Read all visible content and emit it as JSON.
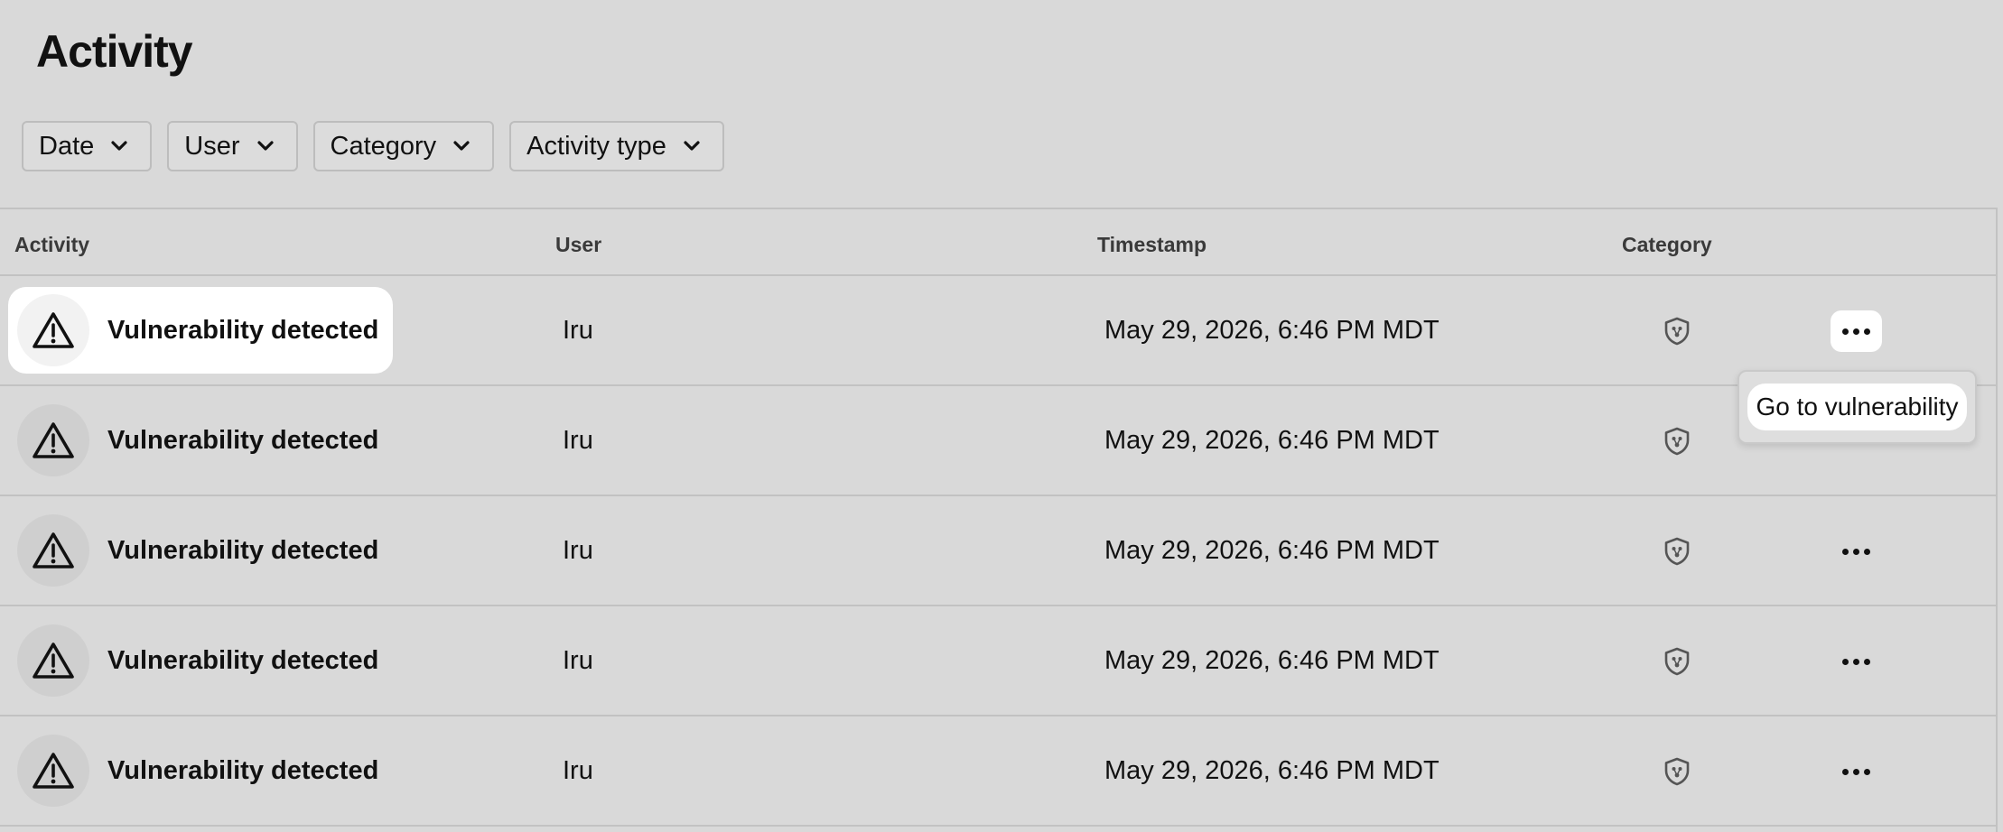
{
  "page": {
    "title": "Activity"
  },
  "filters": [
    {
      "label": "Date"
    },
    {
      "label": "User"
    },
    {
      "label": "Category"
    },
    {
      "label": "Activity type"
    }
  ],
  "table": {
    "headers": {
      "activity": "Activity",
      "user": "User",
      "timestamp": "Timestamp",
      "category": "Category"
    },
    "rows": [
      {
        "activity": "Vulnerability detected",
        "user": "Iru",
        "timestamp": "May 29, 2026, 6:46 PM MDT",
        "category_icon": "shield-icon",
        "highlighted": true
      },
      {
        "activity": "Vulnerability detected",
        "user": "Iru",
        "timestamp": "May 29, 2026, 6:46 PM MDT",
        "category_icon": "shield-icon",
        "highlighted": false
      },
      {
        "activity": "Vulnerability detected",
        "user": "Iru",
        "timestamp": "May 29, 2026, 6:46 PM MDT",
        "category_icon": "shield-icon",
        "highlighted": false
      },
      {
        "activity": "Vulnerability detected",
        "user": "Iru",
        "timestamp": "May 29, 2026, 6:46 PM MDT",
        "category_icon": "shield-icon",
        "highlighted": false
      },
      {
        "activity": "Vulnerability detected",
        "user": "Iru",
        "timestamp": "May 29, 2026, 6:46 PM MDT",
        "category_icon": "shield-icon",
        "highlighted": false
      }
    ]
  },
  "popover": {
    "item_label": "Go to vulnerability"
  },
  "colors": {
    "background": "#d9d9d9",
    "highlight": "#ffffff",
    "border": "#c2c2c2"
  }
}
